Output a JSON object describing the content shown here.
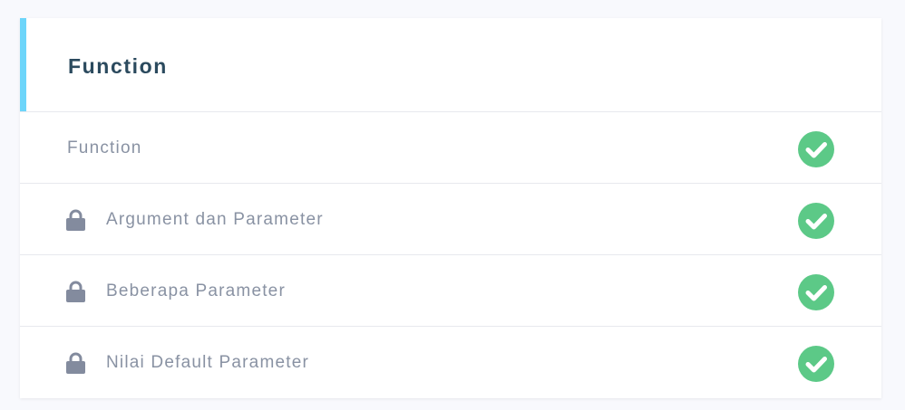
{
  "colors": {
    "accent": "#6dd5fa",
    "check": "#5cc987",
    "lock": "#838b9e"
  },
  "section": {
    "title": "Function",
    "lessons": [
      {
        "label": "Function",
        "locked": false,
        "completed": true,
        "status_icon": "check-circle-icon"
      },
      {
        "label": "Argument dan Parameter",
        "locked": true,
        "completed": true,
        "status_icon": "check-circle-icon"
      },
      {
        "label": "Beberapa Parameter",
        "locked": true,
        "completed": true,
        "status_icon": "check-circle-icon"
      },
      {
        "label": "Nilai Default Parameter",
        "locked": true,
        "completed": true,
        "status_icon": "check-circle-icon"
      }
    ]
  }
}
